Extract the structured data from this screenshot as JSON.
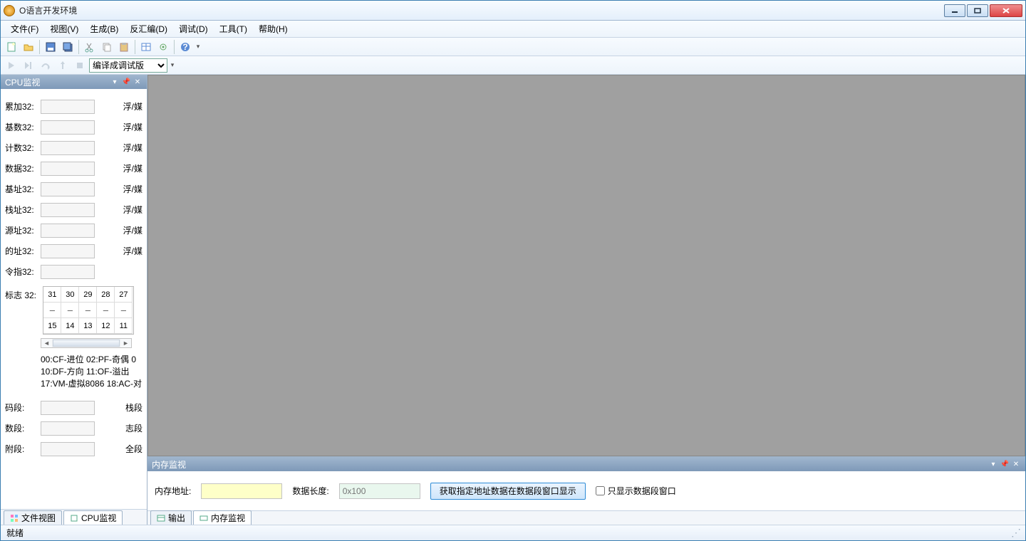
{
  "title": "O语言开发环境",
  "menu": [
    "文件(F)",
    "视图(V)",
    "生成(B)",
    "反汇编(D)",
    "调试(D)",
    "工具(T)",
    "帮助(H)"
  ],
  "build_combo": "编译成调试版",
  "cpu_panel": {
    "title": "CPU监视",
    "registers": [
      {
        "label": "累加32:",
        "right": "浮/媒"
      },
      {
        "label": "基数32:",
        "right": "浮/媒"
      },
      {
        "label": "计数32:",
        "right": "浮/媒"
      },
      {
        "label": "数据32:",
        "right": "浮/媒"
      },
      {
        "label": "基址32:",
        "right": "浮/媒"
      },
      {
        "label": "栈址32:",
        "right": "浮/媒"
      },
      {
        "label": "源址32:",
        "right": "浮/媒"
      },
      {
        "label": "的址32:",
        "right": "浮/媒"
      },
      {
        "label": "令指32:",
        "right": ""
      }
    ],
    "flags_label": "标志 32:",
    "flags_row1": [
      "31",
      "30",
      "29",
      "28",
      "27"
    ],
    "flags_row3": [
      "15",
      "14",
      "13",
      "12",
      "11"
    ],
    "legend": [
      "00:CF-进位  02:PF-奇偶  0",
      "10:DF-方向  11:OF-溢出",
      "17:VM-虚拟8086  18:AC-对"
    ],
    "segs": [
      {
        "label": "码段:",
        "right": "栈段"
      },
      {
        "label": "数段:",
        "right": "志段"
      },
      {
        "label": "附段:",
        "right": "全段"
      }
    ]
  },
  "left_tabs": [
    "文件视图",
    "CPU监视"
  ],
  "mem_panel": {
    "title": "内存监视",
    "addr_label": "内存地址:",
    "len_label": "数据长度:",
    "len_placeholder": "0x100",
    "button": "获取指定地址数据在数据段窗口显示",
    "checkbox": "只显示数据段窗口"
  },
  "mem_tabs": [
    "输出",
    "内存监视"
  ],
  "status": "就绪"
}
